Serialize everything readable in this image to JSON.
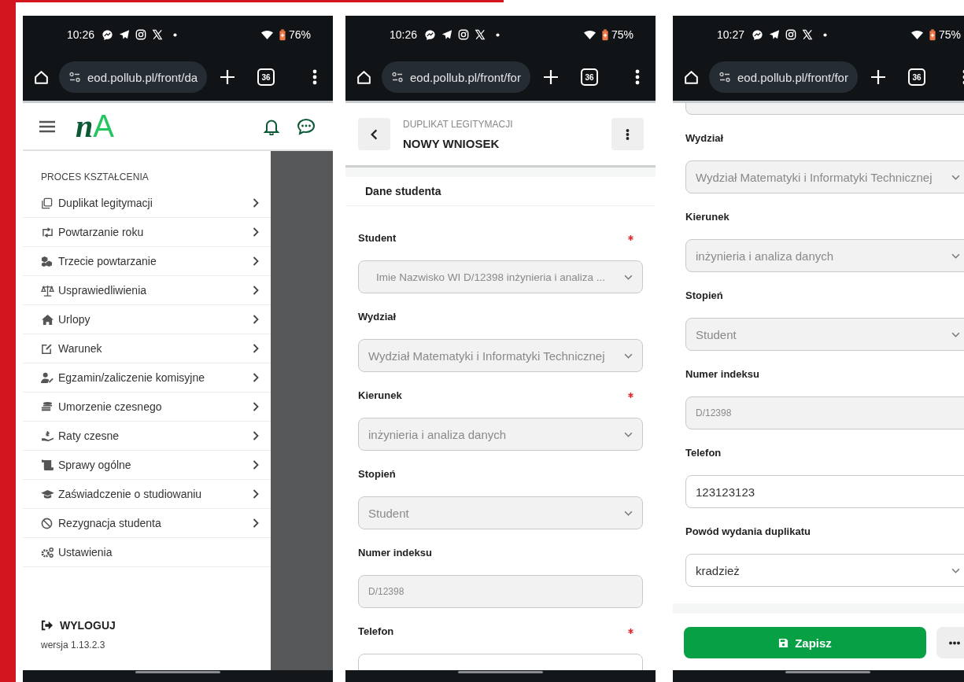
{
  "phones": [
    {
      "kind": "menu",
      "status_bar": {
        "time": "10:26",
        "battery": "76%"
      },
      "browser": {
        "url": "eod.pollub.pl/front/da",
        "tab_count": "36"
      },
      "app_header": {
        "logo": "nA"
      },
      "drawer": {
        "section": "PROCES KSZTAŁCENIA",
        "items": [
          {
            "label": "Duplikat legitymacji",
            "has_submenu": true
          },
          {
            "label": "Powtarzanie roku",
            "has_submenu": true
          },
          {
            "label": "Trzecie powtarzanie",
            "has_submenu": true
          },
          {
            "label": "Usprawiedliwienia",
            "has_submenu": true
          },
          {
            "label": "Urlopy",
            "has_submenu": true
          },
          {
            "label": "Warunek",
            "has_submenu": true
          },
          {
            "label": "Egzamin/zaliczenie komisyjne",
            "has_submenu": true
          },
          {
            "label": "Umorzenie czesnego",
            "has_submenu": true
          },
          {
            "label": "Raty czesne",
            "has_submenu": true
          },
          {
            "label": "Sprawy ogólne",
            "has_submenu": true
          },
          {
            "label": "Zaświadczenie o studiowaniu",
            "has_submenu": true
          },
          {
            "label": "Rezygnacja studenta",
            "has_submenu": true
          },
          {
            "label": "Ustawienia",
            "has_submenu": false
          }
        ],
        "logout": "WYLOGUJ",
        "version": "wersja 1.13.2.3"
      }
    },
    {
      "kind": "form",
      "status_bar": {
        "time": "10:26",
        "battery": "75%"
      },
      "browser": {
        "url": "eod.pollub.pl/front/for",
        "tab_count": "36"
      },
      "page_header": {
        "subtitle": "DUPLIKAT LEGITYMACJI",
        "title": "NOWY WNIOSEK"
      },
      "section": "Dane studenta",
      "fields": [
        {
          "label": "Student",
          "required": true,
          "kind": "select",
          "disabled": true,
          "value": "Imie Nazwisko WI D/12398   inżynieria i analiza ..."
        },
        {
          "label": "Wydział",
          "required": false,
          "kind": "select",
          "disabled": true,
          "value": "Wydział Matematyki i Informatyki Technicznej"
        },
        {
          "label": "Kierunek",
          "required": true,
          "kind": "select",
          "disabled": true,
          "value": "inżynieria i analiza danych"
        },
        {
          "label": "Stopień",
          "required": false,
          "kind": "select",
          "disabled": true,
          "value": "Student"
        },
        {
          "label": "Numer indeksu",
          "required": false,
          "kind": "input",
          "disabled": true,
          "value": "D/12398"
        },
        {
          "label": "Telefon",
          "required": true,
          "kind": "input",
          "disabled": false
        }
      ]
    },
    {
      "kind": "form",
      "status_bar": {
        "time": "10:27",
        "battery": "75%"
      },
      "browser": {
        "url": "eod.pollub.pl/front/for",
        "tab_count": "36"
      },
      "fields": [
        {
          "kind": "select",
          "disabled": true
        },
        {
          "label": "Wydział",
          "required": false,
          "kind": "select",
          "disabled": true,
          "value": "Wydział Matematyki i Informatyki Technicznej"
        },
        {
          "label": "Kierunek",
          "required": false,
          "kind": "select",
          "disabled": true,
          "value": "inżynieria i analiza danych"
        },
        {
          "label": "Stopień",
          "required": false,
          "kind": "select",
          "disabled": true,
          "value": "Student"
        },
        {
          "label": "Numer indeksu",
          "required": false,
          "kind": "input",
          "disabled": true,
          "value": "D/12398"
        },
        {
          "label": "Telefon",
          "required": false,
          "kind": "input",
          "disabled": false,
          "value": "123123123"
        },
        {
          "label": "Powód wydania duplikatu",
          "required": false,
          "kind": "select",
          "disabled": false,
          "value": "kradzież"
        }
      ],
      "actions": {
        "save": "Zapisz"
      }
    }
  ]
}
